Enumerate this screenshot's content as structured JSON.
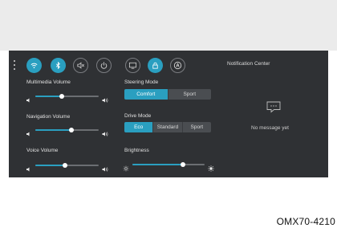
{
  "quick_toggles": [
    {
      "icon": "wifi-icon",
      "state": "on"
    },
    {
      "icon": "bluetooth-icon",
      "state": "on"
    },
    {
      "icon": "mute-icon",
      "state": "off"
    },
    {
      "icon": "power-icon",
      "state": "off"
    },
    {
      "icon": "screen-mirror-icon",
      "state": "on"
    },
    {
      "icon": "lock-icon",
      "state": "on"
    },
    {
      "icon": "auto-hold-icon",
      "state": "off"
    }
  ],
  "volumes": {
    "multimedia": {
      "label": "Multimedia Volume",
      "level": 0.42
    },
    "navigation": {
      "label": "Navigation Volume",
      "level": 0.57
    },
    "voice": {
      "label": "Voice Volume",
      "level": 0.47
    }
  },
  "steering_mode": {
    "label": "Steering Mode",
    "options": [
      "Comfort",
      "Sport"
    ],
    "selected": "Comfort"
  },
  "drive_mode": {
    "label": "Drive Mode",
    "options": [
      "Eco",
      "Standard",
      "Sport"
    ],
    "selected": "Eco"
  },
  "brightness": {
    "label": "Brightness",
    "level": 0.7
  },
  "notifications": {
    "title": "Notification Center",
    "empty_text": "No message yet"
  },
  "caption": "OMX70-4210",
  "colors": {
    "accent": "#2a9fc0",
    "panel": "#2f3134"
  }
}
